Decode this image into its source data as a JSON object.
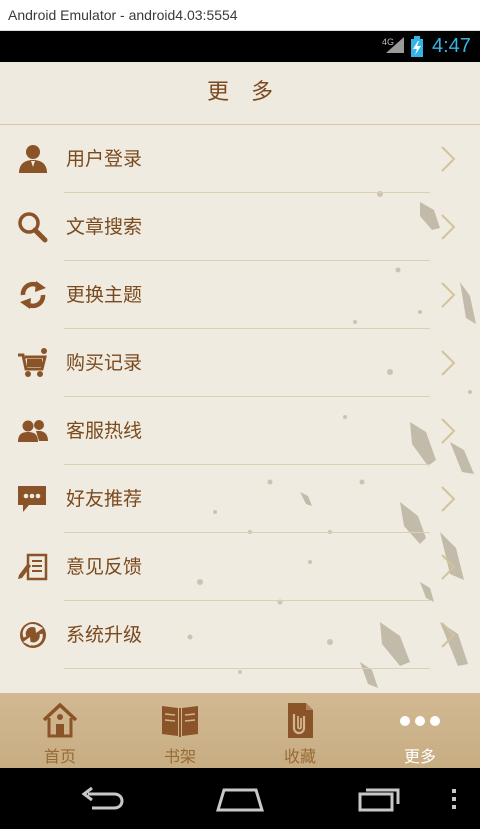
{
  "window": {
    "title": "Android Emulator - android4.03:5554"
  },
  "status_bar": {
    "network": "4G",
    "time": "4:47"
  },
  "header": {
    "title": "更多"
  },
  "menu": {
    "items": [
      {
        "label": "用户登录",
        "icon": "user-icon"
      },
      {
        "label": "文章搜索",
        "icon": "search-icon"
      },
      {
        "label": "更换主题",
        "icon": "refresh-icon"
      },
      {
        "label": "购买记录",
        "icon": "shopping-cart-icon"
      },
      {
        "label": "客服热线",
        "icon": "customer-service-icon"
      },
      {
        "label": "好友推荐",
        "icon": "chat-bubble-icon"
      },
      {
        "label": "意见反馈",
        "icon": "feedback-icon"
      },
      {
        "label": "系统升级",
        "icon": "upgrade-icon"
      }
    ]
  },
  "tabs": [
    {
      "label": "首页",
      "icon": "home-icon",
      "active": false
    },
    {
      "label": "书架",
      "icon": "open-book-icon",
      "active": false
    },
    {
      "label": "收藏",
      "icon": "favorites-icon",
      "active": false
    },
    {
      "label": "更多",
      "icon": "more-dots-icon",
      "active": true
    }
  ],
  "colors": {
    "accent": "#7a4a1e",
    "tab_bar": "#ccb189",
    "page_bg": "#f0ebe0",
    "clock": "#35b5e5"
  }
}
